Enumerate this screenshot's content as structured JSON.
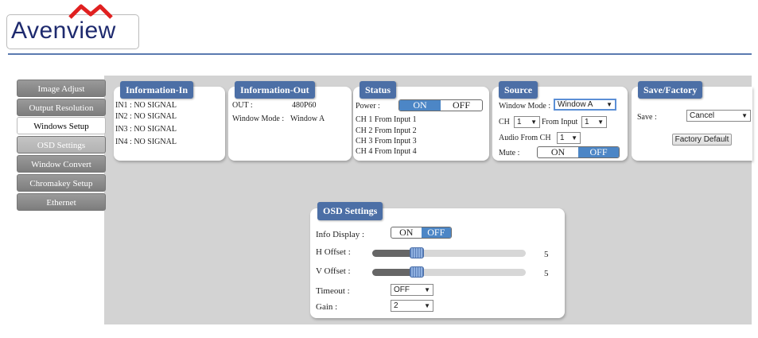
{
  "brand": {
    "name": "Avenview",
    "mark_color": "#e02020",
    "accent": "#4c6fa6"
  },
  "sidebar": {
    "items": [
      {
        "label": "Image Adjust",
        "state": "normal"
      },
      {
        "label": "Output Resolution",
        "state": "normal"
      },
      {
        "label": "Windows Setup",
        "state": "active"
      },
      {
        "label": "OSD Settings",
        "state": "dim"
      },
      {
        "label": "Window Convert",
        "state": "normal"
      },
      {
        "label": "Chromakey Setup",
        "state": "normal"
      },
      {
        "label": "Ethernet",
        "state": "normal"
      }
    ]
  },
  "info_in": {
    "title": "Information-In",
    "lines": [
      "IN1 : NO SIGNAL",
      "IN2 : NO SIGNAL",
      "IN3 : NO SIGNAL",
      "IN4 : NO SIGNAL"
    ]
  },
  "info_out": {
    "title": "Information-Out",
    "out_label": "OUT :",
    "out_value": "480P60",
    "mode_label": "Window Mode :",
    "mode_value": "Window A"
  },
  "status": {
    "title": "Status",
    "power_label": "Power :",
    "on": "ON",
    "off": "OFF",
    "power_selected": "ON",
    "channels": [
      "CH 1 From Input   1",
      "CH 2 From Input   2",
      "CH 3 From Input   3",
      "CH 4 From Input   4"
    ]
  },
  "source": {
    "title": "Source",
    "window_mode_label": "Window Mode :",
    "window_mode_value": "Window A",
    "ch_label": "CH",
    "ch_value": "1",
    "from_input_label": "From Input",
    "from_input_value": "1",
    "audio_label": "Audio From CH",
    "audio_value": "1",
    "mute_label": "Mute :",
    "on": "ON",
    "off": "OFF",
    "mute_selected": "OFF"
  },
  "save_factory": {
    "title": "Save/Factory",
    "save_label": "Save :",
    "save_value": "Cancel",
    "factory_button": "Factory Default"
  },
  "osd": {
    "title": "OSD Settings",
    "info_display_label": "Info Display :",
    "on": "ON",
    "off": "OFF",
    "info_display_selected": "OFF",
    "h_offset_label": "H Offset :",
    "h_offset_value": "5",
    "h_offset_fraction": 0.29,
    "v_offset_label": "V Offset :",
    "v_offset_value": "5",
    "v_offset_fraction": 0.29,
    "timeout_label": "Timeout :",
    "timeout_value": "OFF",
    "gain_label": "Gain :",
    "gain_value": "2"
  }
}
